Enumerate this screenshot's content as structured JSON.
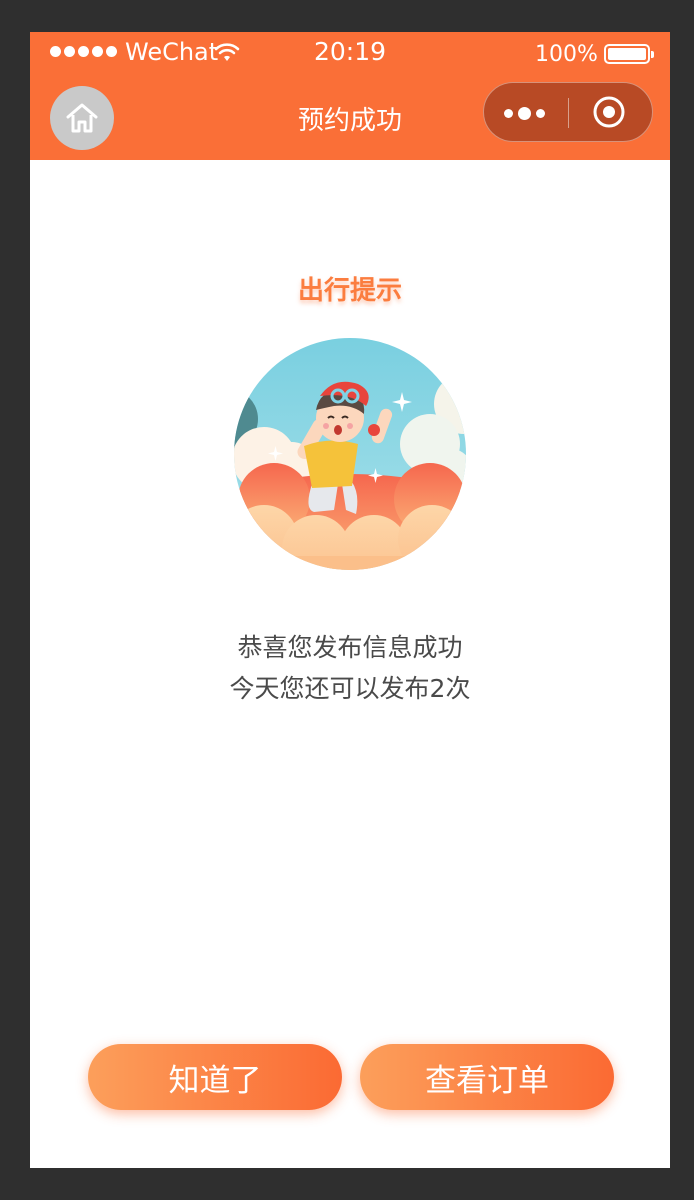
{
  "status_bar": {
    "carrier": "WeChat",
    "time": "20:19",
    "battery_text": "100%"
  },
  "nav": {
    "title": "预约成功",
    "home_icon": "home-icon",
    "more_icon": "more-dots-icon",
    "close_icon": "target-circle-icon",
    "background_color": "#fa6f37"
  },
  "content": {
    "tip_title": "出行提示",
    "illustration": "boy-on-clouds-illustration",
    "message_line1": "恭喜您发布信息成功",
    "message_line2": "今天您还可以发布2次"
  },
  "buttons": {
    "ok_label": "知道了",
    "view_order_label": "查看订单"
  },
  "colors": {
    "accent": "#fa6f37",
    "button_gradient_start": "#fc9f5b",
    "button_gradient_end": "#fb6a33"
  }
}
